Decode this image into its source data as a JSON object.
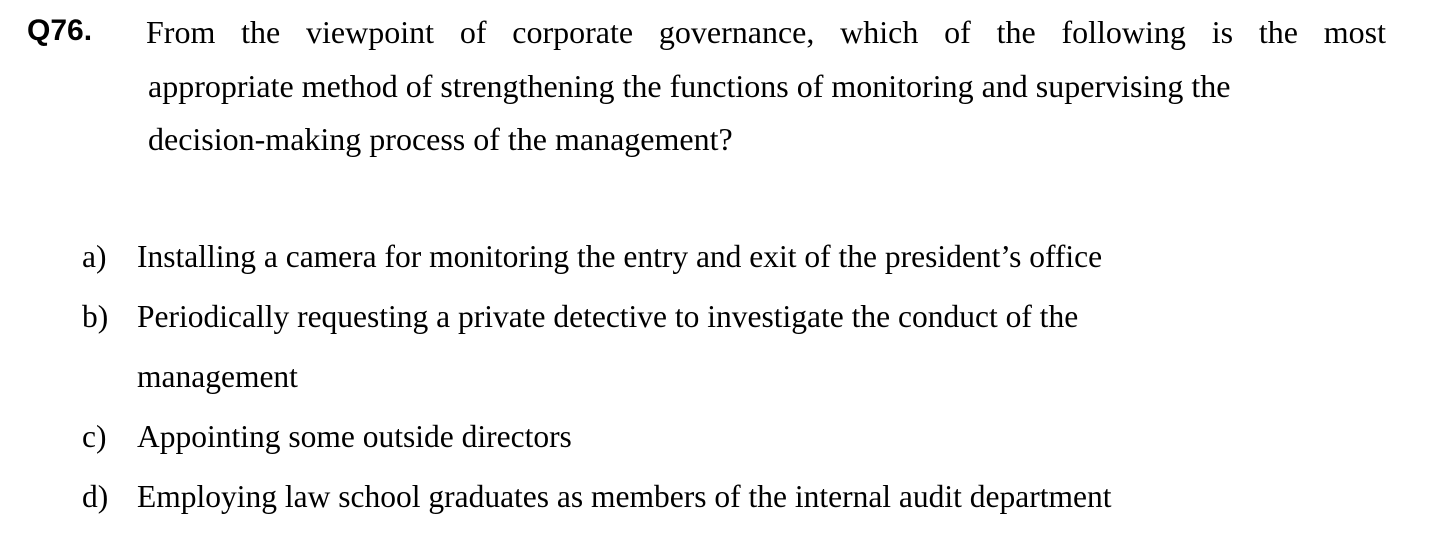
{
  "question": {
    "number": "Q76.",
    "lines": [
      "From the viewpoint of corporate governance, which of the following is the most",
      "appropriate method of strengthening the functions of monitoring and supervising the",
      "decision-making process of the management?"
    ]
  },
  "options": [
    {
      "label": "a)",
      "lines": [
        "Installing a camera for monitoring the entry and exit of the president’s office"
      ]
    },
    {
      "label": "b)",
      "lines": [
        "Periodically requesting a private detective to investigate the conduct of the",
        "management"
      ]
    },
    {
      "label": "c)",
      "lines": [
        "Appointing some outside directors"
      ]
    },
    {
      "label": "d)",
      "lines": [
        "Employing law school graduates as members of the internal audit department"
      ]
    }
  ]
}
